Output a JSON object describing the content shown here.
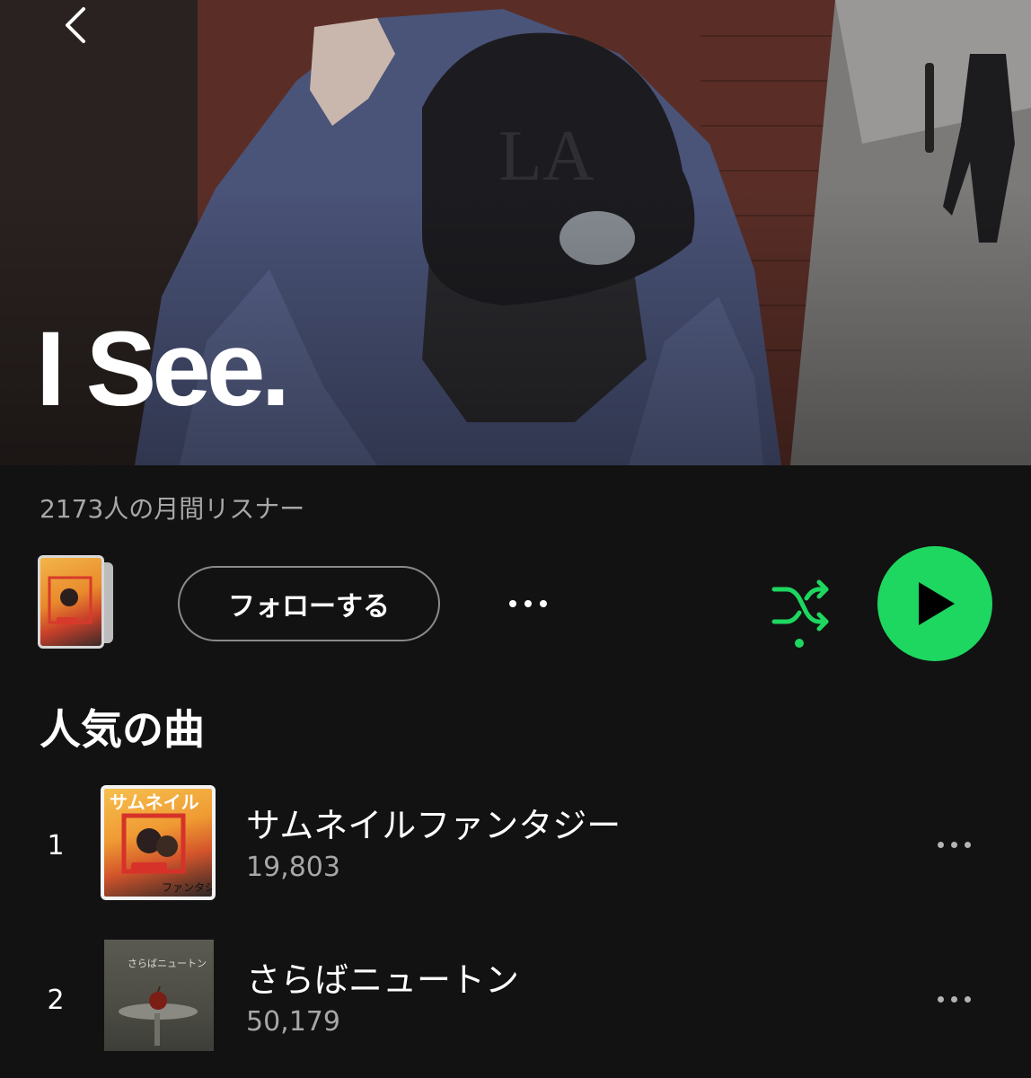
{
  "header": {
    "back_icon": "chevron-left-icon",
    "artist_name": "I See."
  },
  "artist": {
    "monthly_listeners": "2173人の月間リスナー"
  },
  "actions": {
    "follow_label": "フォローする",
    "more_icon": "more-horizontal-icon",
    "shuffle_icon": "shuffle-icon",
    "play_icon": "play-icon",
    "accent_color": "#1ed760"
  },
  "popular": {
    "title": "人気の曲",
    "tracks": [
      {
        "rank": "1",
        "title": "サムネイルファンタジー",
        "plays": "19,803",
        "art_text": "サムネイル",
        "art_sub": "ファンタジー"
      },
      {
        "rank": "2",
        "title": "さらばニュートン",
        "plays": "50,179",
        "art_text": "さらばニュートン"
      }
    ]
  }
}
